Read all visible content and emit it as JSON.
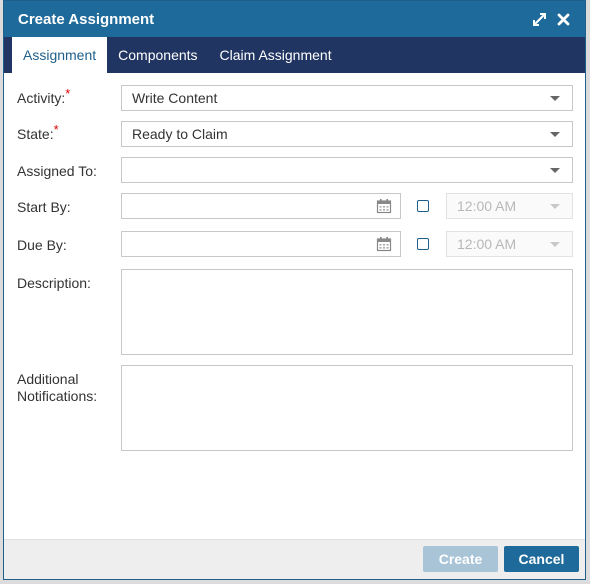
{
  "dialog": {
    "title": "Create Assignment",
    "icons": [
      "expand-icon",
      "close-icon"
    ]
  },
  "tabs": [
    {
      "label": "Assignment",
      "active": true
    },
    {
      "label": "Components",
      "active": false
    },
    {
      "label": "Claim Assignment",
      "active": false
    }
  ],
  "form": {
    "activity": {
      "label": "Activity:",
      "required_mark": "*",
      "value": "Write Content"
    },
    "state": {
      "label": "State:",
      "required_mark": "*",
      "value": "Ready to Claim"
    },
    "assigned_to": {
      "label": "Assigned To:",
      "value": ""
    },
    "start_by": {
      "label": "Start By:",
      "date": "",
      "time": "12:00 AM",
      "time_checked": false
    },
    "due_by": {
      "label": "Due By:",
      "date": "",
      "time": "12:00 AM",
      "time_checked": false
    },
    "description": {
      "label": "Description:",
      "value": ""
    },
    "notifications": {
      "label_line1": "Additional",
      "label_line2": "Notifications:",
      "value": ""
    }
  },
  "footer": {
    "create_label": "Create",
    "cancel_label": "Cancel"
  },
  "colors": {
    "titlebar": "#1e6a9a",
    "tabbar": "#213563",
    "required": "#dd0000",
    "create_disabled": "#a8c4d6"
  }
}
